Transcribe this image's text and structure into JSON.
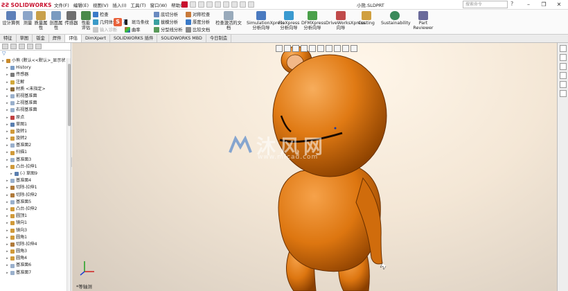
{
  "app": {
    "brand": "SOLIDWORKS",
    "document_title": "小熊.SLDPRT",
    "search_placeholder": "搜索命令"
  },
  "menu": [
    "文件(F)",
    "编辑(E)",
    "视图(V)",
    "插入(I)",
    "工具(T)",
    "窗口(W)",
    "帮助(H)"
  ],
  "window_controls": [
    "–",
    "❐",
    "✕"
  ],
  "ribbon": {
    "design_study": "设计算例",
    "measure": "测量",
    "mass_props": "质量属性",
    "section_props": "剖面属性",
    "sensor": "传感器",
    "performance": "性能评估",
    "check": "检查",
    "geometry_analysis": "几何体分析",
    "import_diagnostics": "输入诊断",
    "zebra": "斑马条纹",
    "curvature": "曲率",
    "draft_analysis": "拔模分析",
    "undercut": "底切分析",
    "parting_line": "分型线分析",
    "symmetry": "对称检查",
    "thickness": "厚度分析",
    "compare": "比较文档",
    "check_active": "检查激活的文档",
    "simxpress": "SimulationXpress 分析向导",
    "floxpress": "FloXpress 分析向导",
    "dfmxpress": "DFMXpress 分析向导",
    "driveworks": "DriveWorksXpress 向导",
    "costing": "Costing",
    "sustainability": "Sustainability",
    "part_reviewer": "Part Reviewer",
    "ime_label": "英"
  },
  "tabs": [
    "特征",
    "草图",
    "钣金",
    "焊件",
    "评估",
    "DimXpert",
    "SOLIDWORKS 插件",
    "SOLIDWORKS MBD",
    "今日制造"
  ],
  "active_tab": "评估",
  "tree": [
    {
      "label": "小熊  (默认<<默认>_显示状",
      "depth": 0,
      "icon": "part-icon",
      "color": "#c88a2c"
    },
    {
      "label": "History",
      "depth": 1,
      "icon": "history-icon",
      "color": "#7a9cc6"
    },
    {
      "label": "传感器",
      "depth": 1,
      "icon": "sensor-icon",
      "color": "#7a7a7a"
    },
    {
      "label": "注解",
      "depth": 1,
      "icon": "annotation-icon",
      "color": "#d1a83a"
    },
    {
      "label": "材质 <未指定>",
      "depth": 1,
      "icon": "material-icon",
      "color": "#8a6a3a"
    },
    {
      "label": "前视基准面",
      "depth": 1,
      "icon": "plane-icon",
      "color": "#9ab0cc"
    },
    {
      "label": "上视基准面",
      "depth": 1,
      "icon": "plane-icon",
      "color": "#9ab0cc"
    },
    {
      "label": "右视基准面",
      "depth": 1,
      "icon": "plane-icon",
      "color": "#9ab0cc"
    },
    {
      "label": "原点",
      "depth": 1,
      "icon": "origin-icon",
      "color": "#c04040"
    },
    {
      "label": "草图1",
      "depth": 1,
      "icon": "sketch-icon",
      "color": "#5a7fb0"
    },
    {
      "label": "旋转1",
      "depth": 1,
      "icon": "revolve-icon",
      "color": "#d09a3a"
    },
    {
      "label": "旋转2",
      "depth": 1,
      "icon": "revolve-icon",
      "color": "#d09a3a"
    },
    {
      "label": "基准面2",
      "depth": 1,
      "icon": "plane-icon",
      "color": "#9ab0cc"
    },
    {
      "label": "扫描1",
      "depth": 1,
      "icon": "sweep-icon",
      "color": "#d09a3a"
    },
    {
      "label": "基准面3",
      "depth": 1,
      "icon": "plane-icon",
      "color": "#9ab0cc"
    },
    {
      "label": "凸台-拉伸1",
      "depth": 1,
      "icon": "extrude-icon",
      "color": "#d09a3a"
    },
    {
      "label": "(-) 草图9",
      "depth": 2,
      "icon": "sketch-icon",
      "color": "#5a7fb0"
    },
    {
      "label": "基准面4",
      "depth": 1,
      "icon": "plane-icon",
      "color": "#9ab0cc"
    },
    {
      "label": "切除-拉伸1",
      "depth": 1,
      "icon": "cut-icon",
      "color": "#b07a3a"
    },
    {
      "label": "切除-拉伸2",
      "depth": 1,
      "icon": "cut-icon",
      "color": "#b07a3a"
    },
    {
      "label": "基准面5",
      "depth": 1,
      "icon": "plane-icon",
      "color": "#9ab0cc"
    },
    {
      "label": "凸台-拉伸2",
      "depth": 1,
      "icon": "extrude-icon",
      "color": "#d09a3a"
    },
    {
      "label": "圆顶1",
      "depth": 1,
      "icon": "dome-icon",
      "color": "#d09a3a"
    },
    {
      "label": "镜向1",
      "depth": 1,
      "icon": "mirror-icon",
      "color": "#d09a3a"
    },
    {
      "label": "镜向3",
      "depth": 1,
      "icon": "mirror-icon",
      "color": "#d09a3a"
    },
    {
      "label": "圆角1",
      "depth": 1,
      "icon": "fillet-icon",
      "color": "#d09a3a"
    },
    {
      "label": "切除-拉伸4",
      "depth": 1,
      "icon": "cut-icon",
      "color": "#b07a3a"
    },
    {
      "label": "圆角3",
      "depth": 1,
      "icon": "fillet-icon",
      "color": "#d09a3a"
    },
    {
      "label": "圆角4",
      "depth": 1,
      "icon": "fillet-icon",
      "color": "#d09a3a"
    },
    {
      "label": "基准面6",
      "depth": 1,
      "icon": "plane-icon",
      "color": "#9ab0cc"
    },
    {
      "label": "基准面7",
      "depth": 1,
      "icon": "plane-icon",
      "color": "#9ab0cc"
    }
  ],
  "viewport": {
    "view_label": "*等轴测",
    "watermark_cn": "沐风网",
    "watermark_url": "www.mfcad.com",
    "model_color": "#d8750f"
  }
}
